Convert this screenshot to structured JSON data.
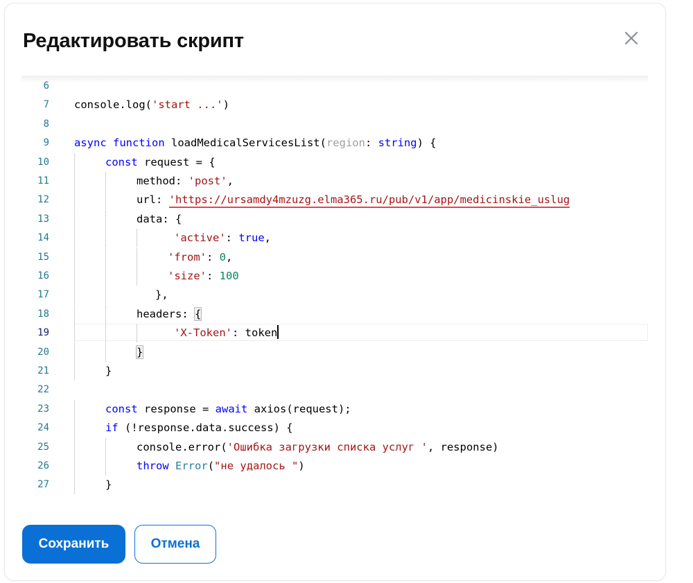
{
  "dialog": {
    "title": "Редактировать скрипт",
    "close_icon": "close-icon"
  },
  "editor": {
    "current_line": "19",
    "lines": [
      {
        "n": "6",
        "indent": 0,
        "tokens": []
      },
      {
        "n": "7",
        "indent": 0,
        "tokens": [
          {
            "t": "plain",
            "v": "console.log("
          },
          {
            "t": "str",
            "v": "'start ...'"
          },
          {
            "t": "plain",
            "v": ")"
          }
        ]
      },
      {
        "n": "8",
        "indent": 0,
        "tokens": []
      },
      {
        "n": "9",
        "indent": 0,
        "tokens": [
          {
            "t": "kw",
            "v": "async"
          },
          {
            "t": "plain",
            "v": " "
          },
          {
            "t": "kw",
            "v": "function"
          },
          {
            "t": "plain",
            "v": " loadMedicalServicesList("
          },
          {
            "t": "param",
            "v": "region"
          },
          {
            "t": "plain",
            "v": ": "
          },
          {
            "t": "kw",
            "v": "string"
          },
          {
            "t": "plain",
            "v": ") {"
          }
        ]
      },
      {
        "n": "10",
        "indent": 1,
        "tokens": [
          {
            "t": "kw",
            "v": "const"
          },
          {
            "t": "plain",
            "v": " request = {"
          }
        ]
      },
      {
        "n": "11",
        "indent": 2,
        "tokens": [
          {
            "t": "plain",
            "v": "method: "
          },
          {
            "t": "str",
            "v": "'post'"
          },
          {
            "t": "plain",
            "v": ","
          }
        ]
      },
      {
        "n": "12",
        "indent": 2,
        "tokens": [
          {
            "t": "plain",
            "v": "url: "
          },
          {
            "t": "strsq",
            "v": "'https://ursamdy4mzuzg.elma365.ru/pub/v1/app/medicinskie_uslug"
          }
        ]
      },
      {
        "n": "13",
        "indent": 2,
        "tokens": [
          {
            "t": "plain",
            "v": "data: {"
          }
        ]
      },
      {
        "n": "14",
        "indent": 3.2,
        "tokens": [
          {
            "t": "str",
            "v": "'active'"
          },
          {
            "t": "plain",
            "v": ": "
          },
          {
            "t": "kw",
            "v": "true"
          },
          {
            "t": "plain",
            "v": ","
          }
        ]
      },
      {
        "n": "15",
        "indent": 3,
        "tokens": [
          {
            "t": "str",
            "v": "'from'"
          },
          {
            "t": "plain",
            "v": ": "
          },
          {
            "t": "num",
            "v": "0"
          },
          {
            "t": "plain",
            "v": ","
          }
        ]
      },
      {
        "n": "16",
        "indent": 3,
        "tokens": [
          {
            "t": "str",
            "v": "'size'"
          },
          {
            "t": "plain",
            "v": ": "
          },
          {
            "t": "num",
            "v": "100"
          }
        ]
      },
      {
        "n": "17",
        "indent": 2.6,
        "tokens": [
          {
            "t": "plain",
            "v": "},"
          }
        ]
      },
      {
        "n": "18",
        "indent": 2,
        "tokens": [
          {
            "t": "plain",
            "v": "headers: "
          },
          {
            "t": "bracket",
            "v": "{"
          }
        ]
      },
      {
        "n": "19",
        "indent": 3.2,
        "tokens": [
          {
            "t": "str",
            "v": "'X-Token'"
          },
          {
            "t": "plain",
            "v": ": token"
          },
          {
            "t": "caret",
            "v": ""
          }
        ]
      },
      {
        "n": "20",
        "indent": 2,
        "tokens": [
          {
            "t": "bracket",
            "v": "}"
          }
        ]
      },
      {
        "n": "21",
        "indent": 1,
        "tokens": [
          {
            "t": "plain",
            "v": "}"
          }
        ]
      },
      {
        "n": "22",
        "indent": 0,
        "tokens": []
      },
      {
        "n": "23",
        "indent": 1,
        "tokens": [
          {
            "t": "kw",
            "v": "const"
          },
          {
            "t": "plain",
            "v": " response = "
          },
          {
            "t": "kw",
            "v": "await"
          },
          {
            "t": "plain",
            "v": " axios(request);"
          }
        ]
      },
      {
        "n": "24",
        "indent": 1,
        "tokens": [
          {
            "t": "kw",
            "v": "if"
          },
          {
            "t": "plain",
            "v": " (!response.data.success) {"
          }
        ]
      },
      {
        "n": "25",
        "indent": 2,
        "tokens": [
          {
            "t": "plain",
            "v": "console.error("
          },
          {
            "t": "str",
            "v": "'Ошибка загрузки списка услуг '"
          },
          {
            "t": "plain",
            "v": ", response)"
          }
        ]
      },
      {
        "n": "26",
        "indent": 2,
        "tokens": [
          {
            "t": "kw",
            "v": "throw"
          },
          {
            "t": "plain",
            "v": " "
          },
          {
            "t": "cls",
            "v": "Error"
          },
          {
            "t": "plain",
            "v": "("
          },
          {
            "t": "str",
            "v": "\"не удалось \""
          },
          {
            "t": "plain",
            "v": ")"
          }
        ]
      },
      {
        "n": "27",
        "indent": 1,
        "tokens": [
          {
            "t": "plain",
            "v": "}"
          }
        ]
      }
    ]
  },
  "footer": {
    "save_label": "Сохранить",
    "cancel_label": "Отмена"
  },
  "colors": {
    "primary": "#0a70d6",
    "keyword": "#0000ff",
    "string": "#a31515",
    "number": "#098658",
    "line_number": "#237893",
    "error_squiggle": "#e0474c"
  }
}
